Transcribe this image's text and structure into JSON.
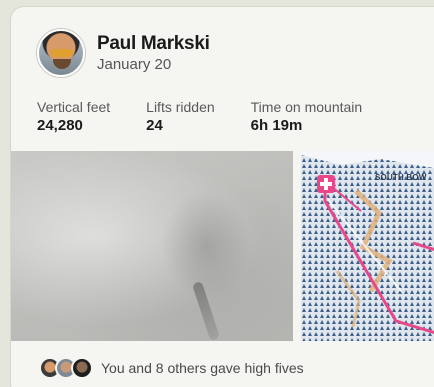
{
  "activity": {
    "athlete_name": "Paul Markski",
    "date": "January 20",
    "stats": [
      {
        "label": "Vertical feet",
        "value": "24,280"
      },
      {
        "label": "Lifts ridden",
        "value": "24"
      },
      {
        "label": "Time on mountain",
        "value": "6h 19m"
      }
    ],
    "map_label": "SOUTH BOW",
    "kudos_text": "You and 8 others gave high fives"
  },
  "colors": {
    "route": "#e8488a",
    "background": "#e4e6dc",
    "card": "#f5f5f2"
  },
  "icons": {
    "lift_marker": "first-aid-cross-icon"
  }
}
